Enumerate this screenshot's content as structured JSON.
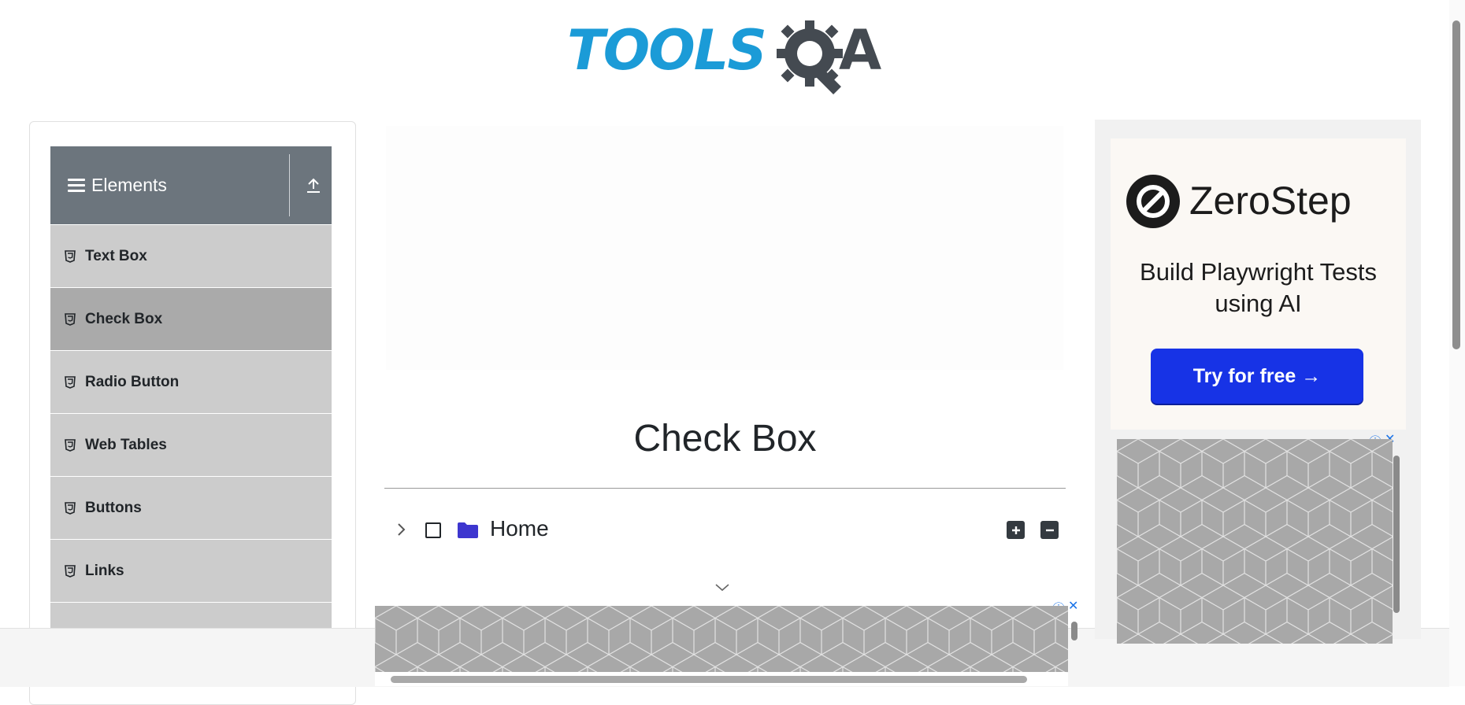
{
  "header": {
    "logo_text_left": "TOOLS",
    "logo_text_right": "A"
  },
  "sidebar": {
    "group_title": "Elements",
    "items": [
      {
        "label": "Text Box",
        "active": false
      },
      {
        "label": "Check Box",
        "active": true
      },
      {
        "label": "Radio Button",
        "active": false
      },
      {
        "label": "Web Tables",
        "active": false
      },
      {
        "label": "Buttons",
        "active": false
      },
      {
        "label": "Links",
        "active": false
      },
      {
        "label": "",
        "active": false
      }
    ]
  },
  "main": {
    "title": "Check Box",
    "tree": {
      "root_label": "Home",
      "expand_all": "+",
      "collapse_all": "−"
    }
  },
  "right_ad": {
    "brand": "ZeroStep",
    "headline": "Build Playwright Tests using AI",
    "cta": "Try for free →"
  },
  "ad_controls": {
    "info": "ⓘ",
    "close": "✕"
  },
  "colors": {
    "logo_blue": "#1b9bd7",
    "logo_dark": "#444a51",
    "sidebar_header": "#6c757d",
    "menu_item_bg": "#cccccc",
    "menu_item_active": "#aaaaaa",
    "folder": "#3d36cf",
    "cta_blue": "#1733e6"
  },
  "icons": [
    "menu-icon",
    "upload-icon",
    "html5-icon",
    "chevron-right-icon",
    "checkbox-icon",
    "folder-icon",
    "plus-square-icon",
    "minus-square-icon",
    "chevron-down-icon",
    "info-icon",
    "close-icon"
  ]
}
